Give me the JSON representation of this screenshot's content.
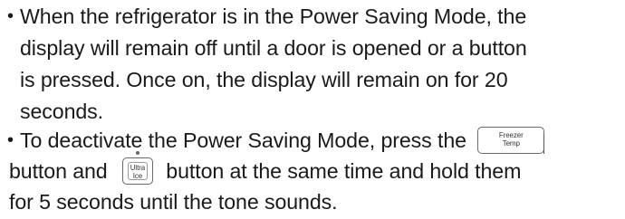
{
  "bullet_symbol": "•",
  "paragraph1": {
    "line1": "When the refrigerator is in the Power Saving Mode, the",
    "line2": "display will remain off until a door is opened or a button",
    "line3": "is pressed. Once on, the display will remain on for 20",
    "line4": "seconds."
  },
  "paragraph2": {
    "line1_text": "To deactivate the Power Saving Mode, press the",
    "freezer_button": {
      "line1": "Freezer",
      "line2": "Temp"
    },
    "line2_part1": "button and",
    "ultra_button": {
      "line1": "Ultra",
      "line2": "Ice"
    },
    "line2_part2": "button at the same time and hold them",
    "line3": "for 5 seconds until the tone sounds."
  }
}
